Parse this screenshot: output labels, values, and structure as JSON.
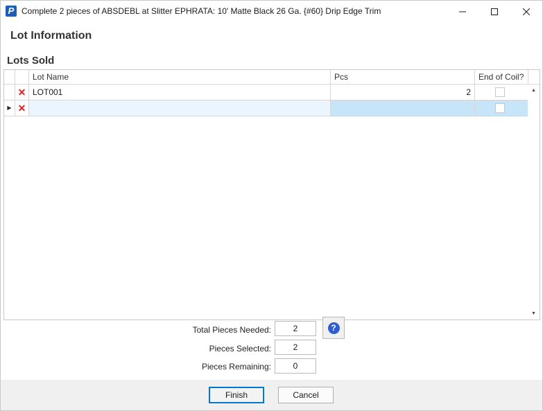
{
  "window": {
    "title": "Complete 2 pieces of ABSDEBL at Slitter EPHRATA: 10'  Matte Black 26 Ga. {#60} Drip Edge Trim",
    "app_icon_letter": "P",
    "minimize_glyph": "—",
    "maximize_glyph": "☐",
    "close_glyph": "✕"
  },
  "section": {
    "title": "Lot Information",
    "subtitle": "Lots Sold"
  },
  "grid": {
    "columns": [
      "",
      "",
      "Lot Name",
      "Pcs",
      "End of Coil?"
    ],
    "rows": [
      {
        "indicator": "",
        "delete": "✕",
        "lot_name": "LOT001",
        "pcs": "2",
        "end_of_coil": false
      },
      {
        "indicator": "▶",
        "delete": "✕",
        "lot_name": "",
        "pcs": "",
        "end_of_coil": false
      }
    ]
  },
  "summary": {
    "total_needed_label": "Total Pieces Needed:",
    "total_needed_value": "2",
    "selected_label": "Pieces Selected:",
    "selected_value": "2",
    "remaining_label": "Pieces Remaining:",
    "remaining_value": "0",
    "help_glyph": "?"
  },
  "footer": {
    "finish_label": "Finish",
    "cancel_label": "Cancel"
  },
  "colors": {
    "selected_cell": "#c7e5f8",
    "delete_icon": "#e02020",
    "help_icon": "#2b5fd0",
    "primary_border": "#0078d4"
  }
}
